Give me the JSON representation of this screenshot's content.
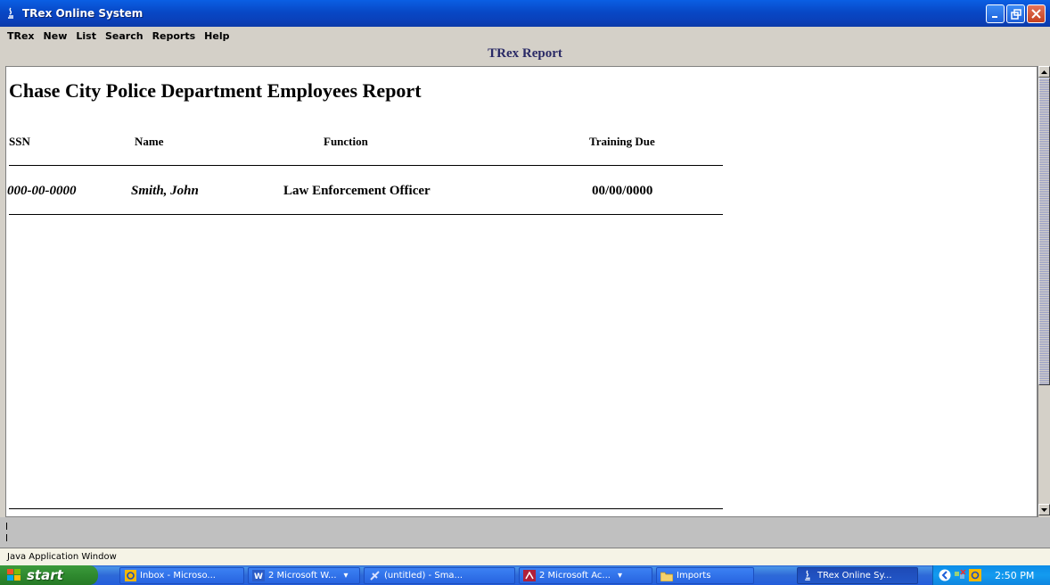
{
  "window": {
    "title": "TRex Online System"
  },
  "menu": {
    "items": [
      {
        "label": "TRex"
      },
      {
        "label": "New"
      },
      {
        "label": "List"
      },
      {
        "label": "Search"
      },
      {
        "label": "Reports"
      },
      {
        "label": "Help"
      }
    ]
  },
  "report": {
    "caption": "TRex Report",
    "title": "Chase City Police Department Employees Report",
    "columns": [
      "SSN",
      "Name",
      "Function",
      "Training Due"
    ],
    "rows": [
      {
        "ssn": "000-00-0000",
        "name": "Smith, John",
        "function": "Law Enforcement Officer",
        "training_due": "00/00/0000"
      }
    ]
  },
  "status_bar": {
    "text": "Java Application Window"
  },
  "taskbar": {
    "start_label": "start",
    "buttons": [
      {
        "label": "Inbox - Microso...",
        "icon": "outlook-icon"
      },
      {
        "label": "2 Microsoft W...",
        "icon": "word-icon"
      },
      {
        "label": "(untitled) - Sma...",
        "icon": "smartdraw-icon"
      },
      {
        "label": "2 Microsoft Ac...",
        "icon": "access-icon"
      },
      {
        "label": "Imports",
        "icon": "folder-icon"
      },
      {
        "label": "TRex Online Sy...",
        "icon": "java-icon"
      }
    ],
    "clock": "2:50 PM"
  },
  "colors": {
    "titlebar": "#0848c6",
    "caption": "#2a2a66",
    "taskbar": "#245edb",
    "start": "#2f8a2f"
  }
}
